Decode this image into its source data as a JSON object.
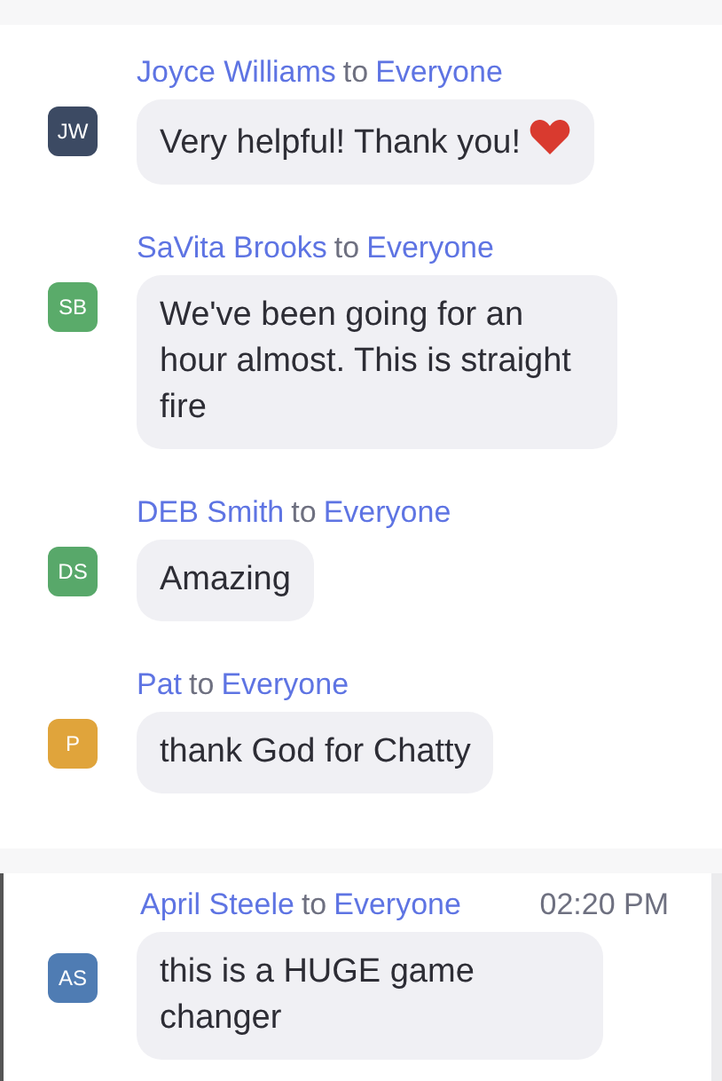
{
  "messages": [
    {
      "sender": "Joyce Williams",
      "to_word": "to",
      "recipient": "Everyone",
      "initials": "JW",
      "color": "#3c4a63",
      "text": "Very helpful! Thank you!",
      "heart": true
    },
    {
      "sender": "SaVita Brooks",
      "to_word": "to",
      "recipient": "Everyone",
      "initials": "SB",
      "color": "#5aab6a",
      "text": "We've been going for an hour almost. This is straight fire",
      "heart": false
    },
    {
      "sender": "DEB Smith",
      "to_word": "to",
      "recipient": "Everyone",
      "initials": "DS",
      "color": "#58a86a",
      "text": "Amazing",
      "heart": false
    },
    {
      "sender": "Pat",
      "to_word": "to",
      "recipient": "Everyone",
      "initials": "P",
      "color": "#e0a43b",
      "text": "thank God for Chatty",
      "heart": false
    }
  ],
  "pinned": {
    "sender": "April Steele",
    "to_word": "to",
    "recipient": "Everyone",
    "time": "02:20 PM",
    "initials": "AS",
    "color": "#4f7cb3",
    "text": "this is a HUGE game changer"
  }
}
